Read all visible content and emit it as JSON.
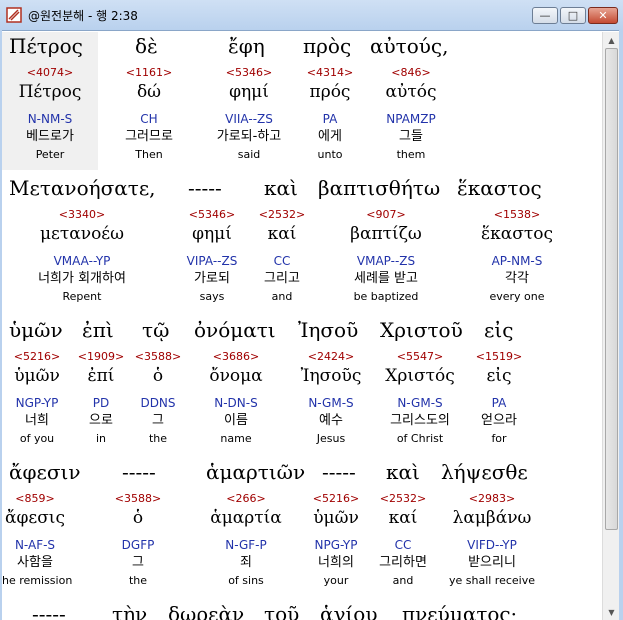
{
  "window": {
    "title": "@원전분해 - 행 2:38",
    "min_label": "—",
    "max_label": "□",
    "close_label": "✕"
  },
  "lines": [
    {
      "greek": [
        "Πέτρος",
        "δὲ",
        "ἔφη",
        "πρὸς",
        "αὐτούς,"
      ],
      "words": [
        {
          "strong": "<4074>",
          "lemma": "Πέτρος",
          "parse": "N-NM-S",
          "korean": "베드로가",
          "english": "Peter"
        },
        {
          "strong": "<1161>",
          "lemma": "δώ",
          "parse": "CH",
          "korean": "그러므로",
          "english": "Then"
        },
        {
          "strong": "<5346>",
          "lemma": "φημί",
          "parse": "VIIA--ZS",
          "korean": "가로되-하고",
          "english": "said"
        },
        {
          "strong": "<4314>",
          "lemma": "πρός",
          "parse": "PA",
          "korean": "에게",
          "english": "unto"
        },
        {
          "strong": "<846>",
          "lemma": "αὐτός",
          "parse": "NPAMZP",
          "korean": "그들",
          "english": "them"
        }
      ]
    },
    {
      "greek": [
        "Μετανοήσατε,",
        "-----",
        "καὶ",
        "βαπτισθήτω",
        "ἕκαστος"
      ],
      "words": [
        {
          "strong": "<3340>",
          "lemma": "μετανοέω",
          "parse": "VMAA--YP",
          "korean": "너희가 회개하여",
          "english": "Repent"
        },
        {
          "strong": "<5346>",
          "lemma": "φημί",
          "parse": "VIPA--ZS",
          "korean": "가로되",
          "english": "says"
        },
        {
          "strong": "<2532>",
          "lemma": "καί",
          "parse": "CC",
          "korean": "그리고",
          "english": "and"
        },
        {
          "strong": "<907>",
          "lemma": "βαπτίζω",
          "parse": "VMAP--ZS",
          "korean": "세례를 받고",
          "english": "be baptized"
        },
        {
          "strong": "<1538>",
          "lemma": "ἕκαστος",
          "parse": "AP-NM-S",
          "korean": "각각",
          "english": "every one"
        }
      ]
    },
    {
      "greek": [
        "ὑμῶν",
        "ἐπὶ",
        "τῷ",
        "ὀνόματι",
        "Ἰησοῦ",
        "Χριστοῦ",
        "εἰς"
      ],
      "words": [
        {
          "strong": "<5216>",
          "lemma": "ὑμῶν",
          "parse": "NGP-YP",
          "korean": "너희",
          "english": "of you"
        },
        {
          "strong": "<1909>",
          "lemma": "ἐπί",
          "parse": "PD",
          "korean": "으로",
          "english": "in"
        },
        {
          "strong": "<3588>",
          "lemma": "ὁ",
          "parse": "DDNS",
          "korean": "그",
          "english": "the"
        },
        {
          "strong": "<3686>",
          "lemma": "ὄνομα",
          "parse": "N-DN-S",
          "korean": "이름",
          "english": "name"
        },
        {
          "strong": "<2424>",
          "lemma": "Ἰησοῦς",
          "parse": "N-GM-S",
          "korean": "예수",
          "english": "Jesus"
        },
        {
          "strong": "<5547>",
          "lemma": "Χριστός",
          "parse": "N-GM-S",
          "korean": "그리스도의",
          "english": "of Christ"
        },
        {
          "strong": "<1519>",
          "lemma": "εἰς",
          "parse": "PA",
          "korean": "얻으라",
          "english": "for"
        }
      ]
    },
    {
      "greek": [
        "ἄφεσιν",
        "-----",
        "ἁμαρτιῶν",
        "-----",
        "καὶ",
        "λήψεσθε"
      ],
      "words": [
        {
          "strong": "<859>",
          "lemma": "ἄφεσις",
          "parse": "N-AF-S",
          "korean": "사함을",
          "english": "the remission"
        },
        {
          "strong": "<3588>",
          "lemma": "ὁ",
          "parse": "DGFP",
          "korean": "그",
          "english": "the"
        },
        {
          "strong": "<266>",
          "lemma": "ἁμαρτία",
          "parse": "N-GF-P",
          "korean": "죄",
          "english": "of sins"
        },
        {
          "strong": "<5216>",
          "lemma": "ὑμῶν",
          "parse": "NPG-YP",
          "korean": "너희의",
          "english": "your"
        },
        {
          "strong": "<2532>",
          "lemma": "καί",
          "parse": "CC",
          "korean": "그리하면",
          "english": "and"
        },
        {
          "strong": "<2983>",
          "lemma": "λαμβάνω",
          "parse": "VIFD--YP",
          "korean": "받으리니",
          "english": "ye shall receive"
        }
      ]
    },
    {
      "greek": [
        "-----",
        "τὴν",
        "δωρεὰν",
        "τοῦ",
        "ἁγίου",
        "πνεύματος·"
      ],
      "words": []
    }
  ]
}
